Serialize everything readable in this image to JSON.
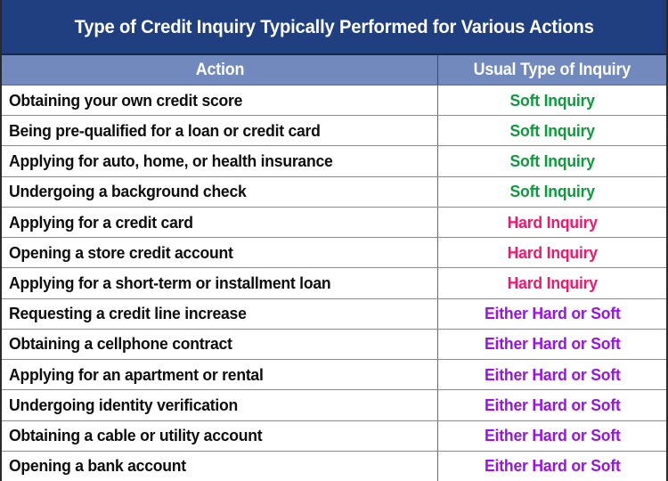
{
  "title": "Type of Credit Inquiry Typically Performed for Various Actions",
  "columns": {
    "action": "Action",
    "inquiry": "Usual Type of Inquiry"
  },
  "colors": {
    "title_bg": "#1f3f81",
    "header_bg": "#7289bd",
    "soft": "#0b9b3c",
    "hard": "#f5156c",
    "either": "#9912e8",
    "action_text": "#0d0d0d",
    "grid_line": "#8c8c8c"
  },
  "legend_values": {
    "soft": "Soft Inquiry",
    "hard": "Hard Inquiry",
    "either": "Either Hard or Soft"
  },
  "rows": [
    {
      "action": "Obtaining your own credit score",
      "inquiry": "Soft Inquiry",
      "kind": "soft"
    },
    {
      "action": "Being pre-qualified for a loan or credit card",
      "inquiry": "Soft Inquiry",
      "kind": "soft"
    },
    {
      "action": "Applying for auto, home, or health insurance",
      "inquiry": "Soft Inquiry",
      "kind": "soft"
    },
    {
      "action": "Undergoing a background check",
      "inquiry": "Soft Inquiry",
      "kind": "soft"
    },
    {
      "action": "Applying for a credit card",
      "inquiry": "Hard Inquiry",
      "kind": "hard"
    },
    {
      "action": "Opening a store credit account",
      "inquiry": "Hard Inquiry",
      "kind": "hard"
    },
    {
      "action": "Applying for a short-term or installment loan",
      "inquiry": "Hard Inquiry",
      "kind": "hard"
    },
    {
      "action": "Requesting a credit line increase",
      "inquiry": "Either Hard or Soft",
      "kind": "both"
    },
    {
      "action": "Obtaining a cellphone contract",
      "inquiry": "Either Hard or Soft",
      "kind": "both"
    },
    {
      "action": "Applying for an apartment or rental",
      "inquiry": "Either Hard or Soft",
      "kind": "both"
    },
    {
      "action": "Undergoing identity verification",
      "inquiry": "Either Hard or Soft",
      "kind": "both"
    },
    {
      "action": "Obtaining a cable or utility account",
      "inquiry": "Either Hard or Soft",
      "kind": "both"
    },
    {
      "action": "Opening a bank account",
      "inquiry": "Either Hard or Soft",
      "kind": "both"
    }
  ]
}
